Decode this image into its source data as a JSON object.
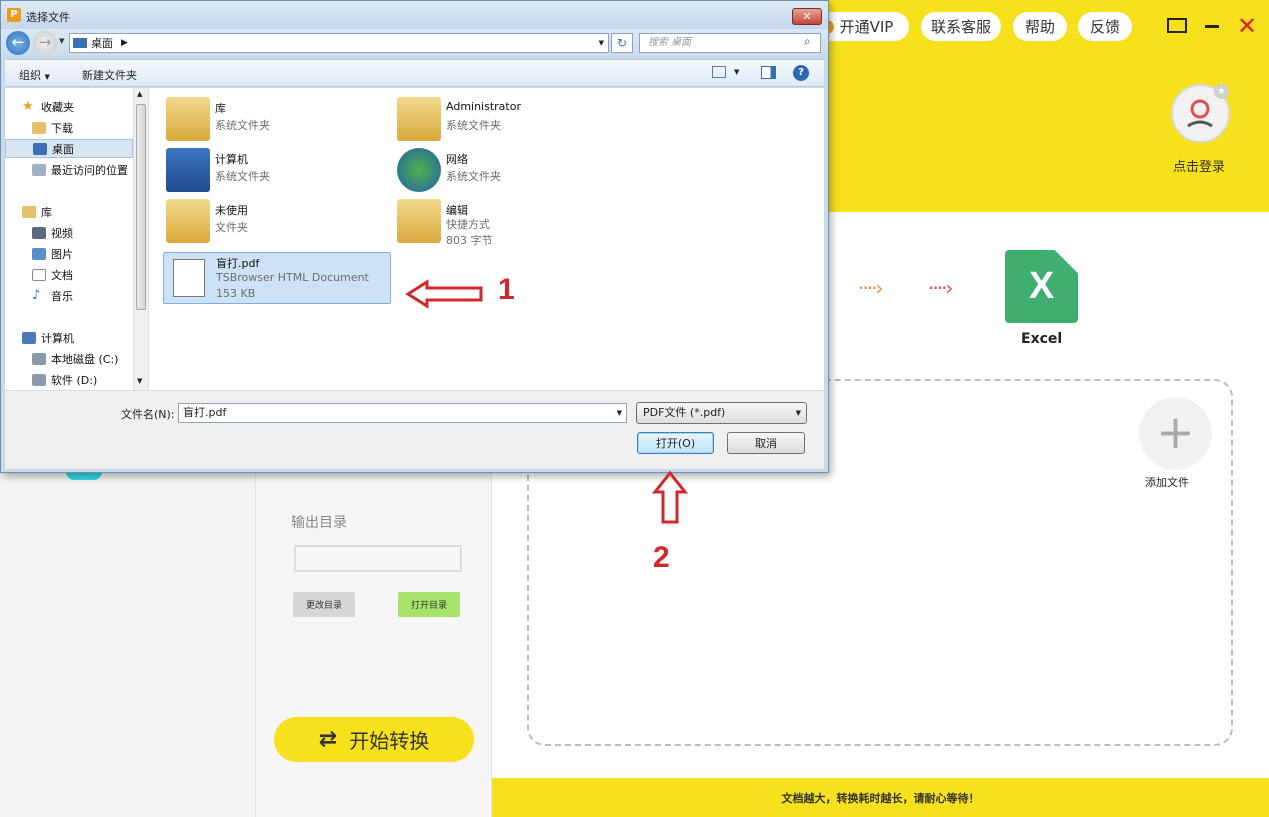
{
  "app": {
    "top_buttons": [
      "开通VIP",
      "联系客服",
      "帮助",
      "反馈"
    ],
    "login_label": "点击登录",
    "excel_label": "Excel",
    "add_file_label": "添加文件",
    "output_dir_label": "输出目录",
    "output_dir_value": "",
    "change_dir_button": "更改目录",
    "open_dir_button": "打开目录",
    "start_button": "开始转换",
    "footer_notice": "文档越大，转换耗时越长，请耐心等待！"
  },
  "dialog": {
    "title": "选择文件",
    "address": "桌面",
    "search_placeholder": "搜索 桌面",
    "toolbar": {
      "organize": "组织",
      "new_folder": "新建文件夹"
    },
    "nav": [
      {
        "label": "收藏夹",
        "icon": "star-icon",
        "indent": 0
      },
      {
        "label": "下载",
        "icon": "download-folder-icon",
        "indent": 1
      },
      {
        "label": "桌面",
        "icon": "desktop-icon",
        "indent": 1,
        "selected": true
      },
      {
        "label": "最近访问的位置",
        "icon": "recent-places-icon",
        "indent": 1
      },
      {
        "label": "库",
        "icon": "library-icon",
        "indent": 0
      },
      {
        "label": "视频",
        "icon": "video-icon",
        "indent": 1
      },
      {
        "label": "图片",
        "icon": "picture-icon",
        "indent": 1
      },
      {
        "label": "文档",
        "icon": "document-icon",
        "indent": 1
      },
      {
        "label": "音乐",
        "icon": "music-icon",
        "indent": 1
      },
      {
        "label": "计算机",
        "icon": "computer-icon",
        "indent": 0
      },
      {
        "label": "本地磁盘 (C:)",
        "icon": "drive-icon",
        "indent": 1
      },
      {
        "label": "软件 (D:)",
        "icon": "drive-icon",
        "indent": 1
      }
    ],
    "files": [
      {
        "name": "库",
        "sub1": "系统文件夹",
        "sub2": "",
        "icon": "library-folder-icon"
      },
      {
        "name": "Administrator",
        "sub1": "系统文件夹",
        "sub2": "",
        "icon": "user-folder-icon"
      },
      {
        "name": "计算机",
        "sub1": "系统文件夹",
        "sub2": "",
        "icon": "computer-icon"
      },
      {
        "name": "网络",
        "sub1": "系统文件夹",
        "sub2": "",
        "icon": "network-icon"
      },
      {
        "name": "未使用",
        "sub1": "文件夹",
        "sub2": "",
        "icon": "folder-icon"
      },
      {
        "name": "编辑",
        "sub1": "快捷方式",
        "sub2": "803 字节",
        "icon": "shortcut-folder-icon"
      },
      {
        "name": "盲打.pdf",
        "sub1": "TSBrowser HTML Document",
        "sub2": "153 KB",
        "icon": "pdf-file-icon",
        "selected": true
      }
    ],
    "filename_label": "文件名(N):",
    "filename_value": "盲打.pdf",
    "filetype_value": "PDF文件 (*.pdf)",
    "open_button": "打开(O)",
    "cancel_button": "取消"
  },
  "annotations": {
    "step1": "1",
    "step2": "2",
    "arrow_color": "#d0282b"
  },
  "colors": {
    "brand_yellow": "#f7e11d",
    "excel_green": "#3fae6f"
  }
}
